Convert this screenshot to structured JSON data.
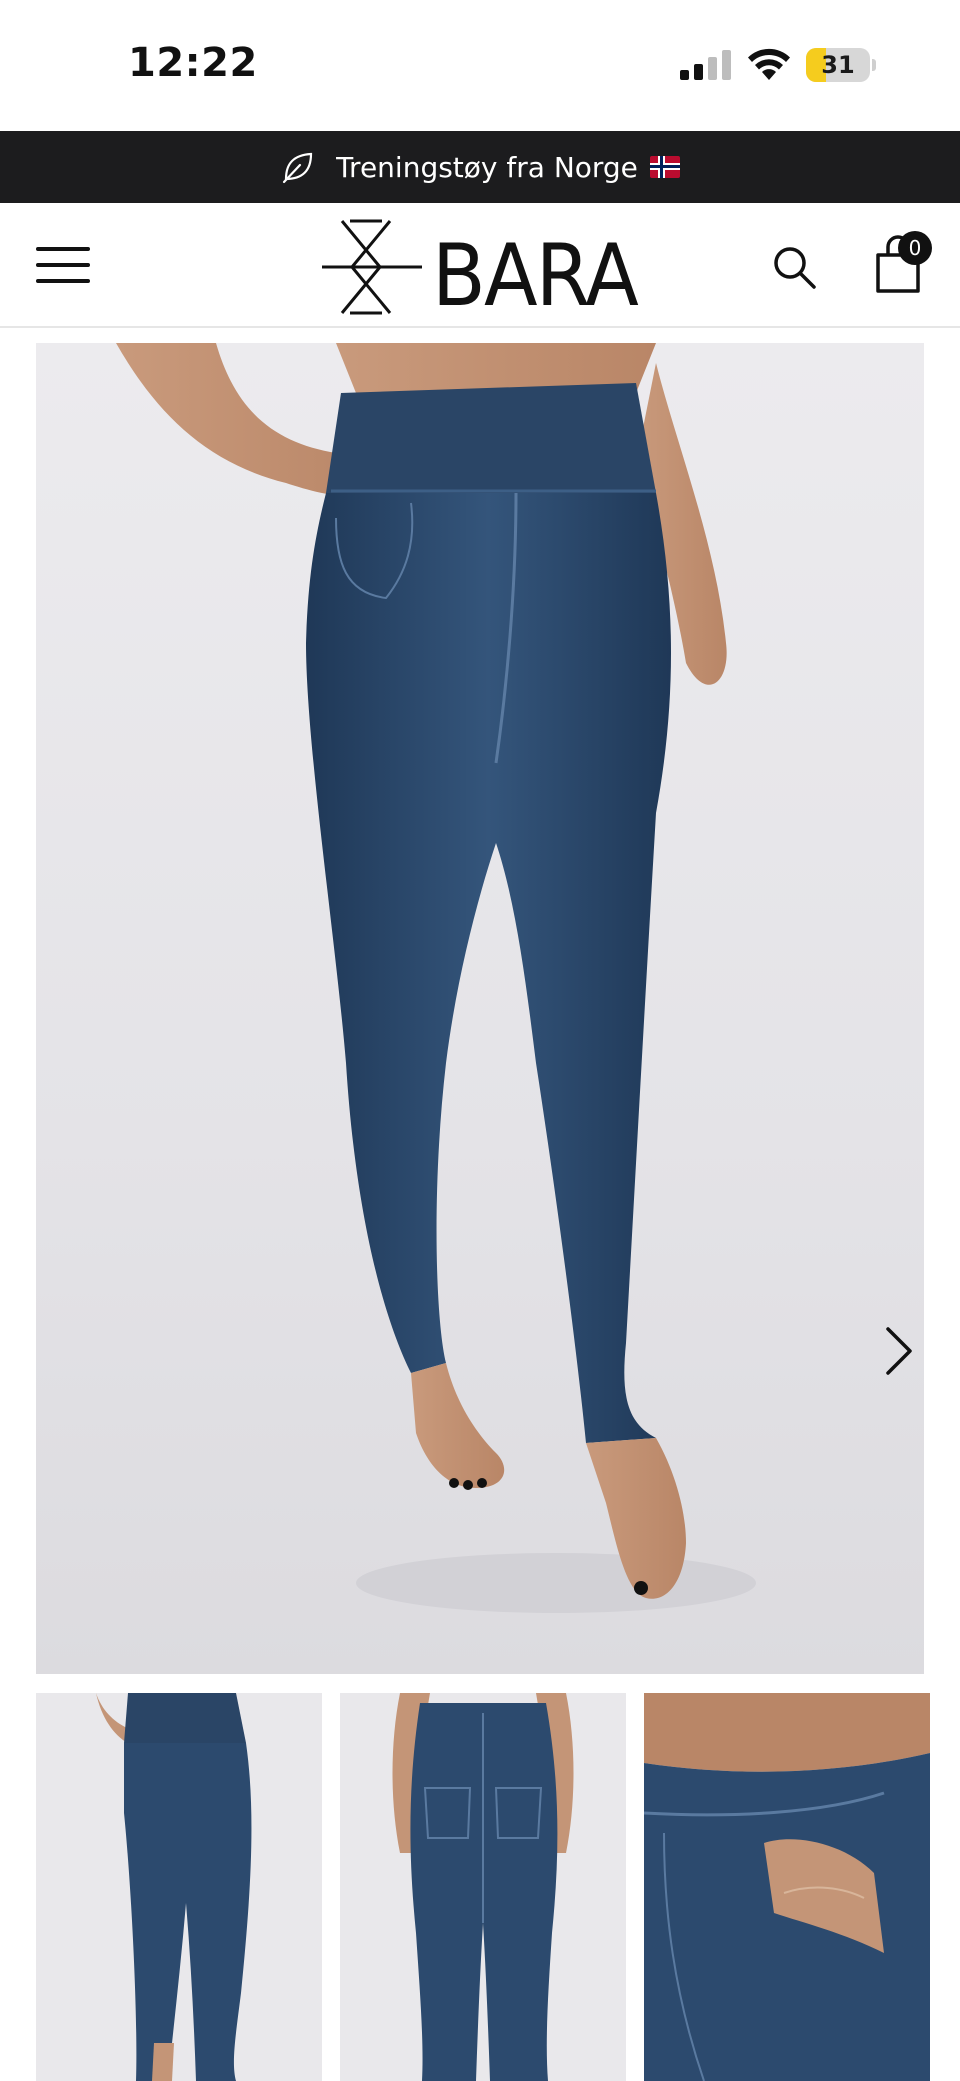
{
  "status_bar": {
    "time": "12:22",
    "battery_level": "31",
    "battery_fraction": 0.31,
    "battery_color": "#f5cc1e",
    "icons": [
      "signal-icon",
      "wifi-icon",
      "battery-icon"
    ]
  },
  "announcement": {
    "text": "Treningstøy fra Norge",
    "icon": "leaf-icon",
    "flag": "norway-flag-icon",
    "background": "#1c1c1e"
  },
  "header": {
    "brand": "BARA",
    "menu_icon": "hamburger-menu-icon",
    "search_icon": "search-icon",
    "cart_icon": "shopping-bag-icon",
    "cart_count": "0"
  },
  "gallery": {
    "main_image": "denim-leggings-front-view",
    "next_icon": "chevron-right-icon",
    "thumbnails": [
      {
        "name": "thumbnail-front"
      },
      {
        "name": "thumbnail-back"
      },
      {
        "name": "thumbnail-pocket-detail"
      }
    ],
    "denim_color": "#2c4a6e"
  }
}
